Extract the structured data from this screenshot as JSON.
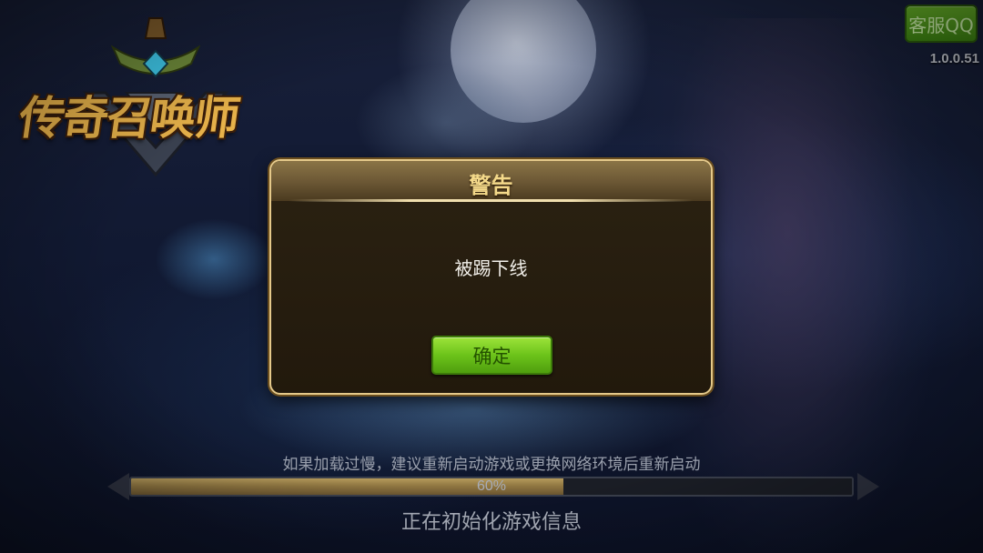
{
  "game": {
    "logo_text": "传奇召唤师"
  },
  "top_right": {
    "service_button": "客服QQ",
    "version": "1.0.0.51"
  },
  "dialog": {
    "title": "警告",
    "message": "被踢下线",
    "confirm_button": "确定"
  },
  "loading": {
    "tip": "如果加载过慢，建议重新启动游戏或更换网络环境后重新启动",
    "progress": 0.6,
    "progress_label": "60%",
    "status": "正在初始化游戏信息"
  },
  "colors": {
    "dialog_border": "#e5c98a",
    "button_green": "#6cc31a",
    "title_gold": "#f4d98a",
    "progress_gold": "#8d7440"
  }
}
